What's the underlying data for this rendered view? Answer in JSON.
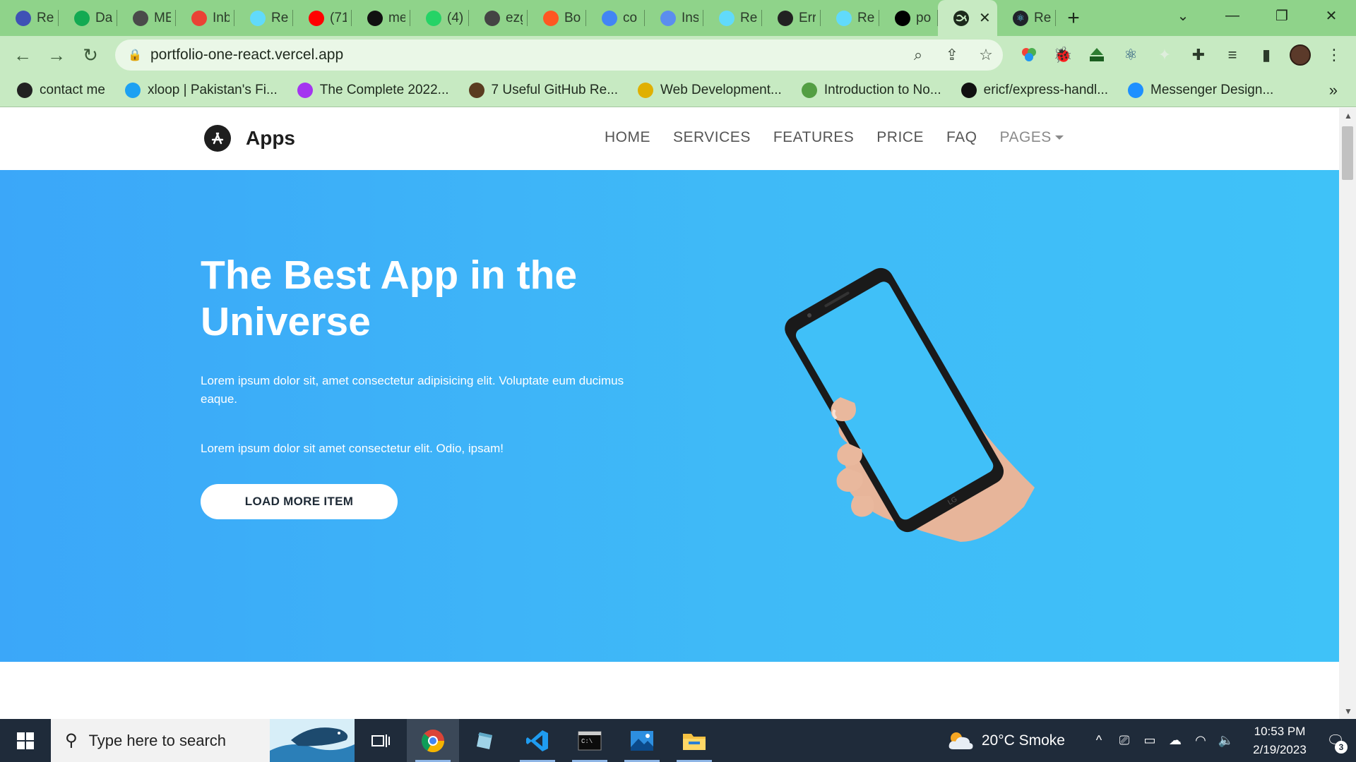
{
  "browser": {
    "tabs": [
      {
        "title": "Re",
        "icon": "m-icon",
        "color": "#3f51b5"
      },
      {
        "title": "Da",
        "icon": "mongodb-leaf-icon",
        "color": "#13aa52"
      },
      {
        "title": "ME",
        "icon": "openai-icon",
        "color": "#4a4a4a"
      },
      {
        "title": "Inb",
        "icon": "gmail-icon",
        "color": "#ea4335"
      },
      {
        "title": "Re",
        "icon": "react-icon",
        "color": "#61dafb"
      },
      {
        "title": "(71",
        "icon": "youtube-icon",
        "color": "#ff0000"
      },
      {
        "title": "me",
        "icon": "github-icon",
        "color": "#111111"
      },
      {
        "title": "(4)",
        "icon": "whatsapp-icon",
        "color": "#25d366"
      },
      {
        "title": "ezg",
        "icon": "ezgif-icon",
        "color": "#444444"
      },
      {
        "title": "Bo",
        "icon": "bolt-icon",
        "color": "#ff5722"
      },
      {
        "title": "co",
        "icon": "google-icon",
        "color": "#4285f4"
      },
      {
        "title": "Ins",
        "icon": "flag-icon",
        "color": "#5b8def"
      },
      {
        "title": "Re",
        "icon": "react-icon",
        "color": "#61dafb"
      },
      {
        "title": "Err",
        "icon": "globe-icon",
        "color": "#222222"
      },
      {
        "title": "Re",
        "icon": "react-icon",
        "color": "#61dafb"
      },
      {
        "title": "po",
        "icon": "vercel-icon",
        "color": "#000000"
      }
    ],
    "active_tab": {
      "title": "",
      "icon": "globe-icon",
      "close": "✕"
    },
    "last_tab": {
      "title": "Re",
      "icon": "react-icon"
    },
    "new_tab_label": "+",
    "url": "portfolio-one-react.vercel.app",
    "bookmarks": [
      {
        "label": "contact me",
        "icon": "globe-icon",
        "color": "#222222"
      },
      {
        "label": "xloop | Pakistan's Fi...",
        "icon": "xloop-icon",
        "color": "#1da1f2"
      },
      {
        "label": "The Complete 2022...",
        "icon": "udemy-icon",
        "color": "#a435f0"
      },
      {
        "label": "7 Useful GitHub Re...",
        "icon": "dev-icon",
        "color": "#5a3c20"
      },
      {
        "label": "Web Development...",
        "icon": "coin-icon",
        "color": "#e0b000"
      },
      {
        "label": "Introduction to No...",
        "icon": "nodejs-icon",
        "color": "#539e43"
      },
      {
        "label": "ericf/express-handl...",
        "icon": "github-icon",
        "color": "#111111"
      },
      {
        "label": "Messenger Design...",
        "icon": "search-app-icon",
        "color": "#1e90ff"
      }
    ]
  },
  "site": {
    "brand": "Apps",
    "brand_logo_letter": "A",
    "nav": [
      "HOME",
      "SERVICES",
      "FEATURES",
      "PRICE",
      "FAQ"
    ],
    "nav_dropdown": "PAGES",
    "hero": {
      "title": "The Best App in the Universe",
      "p1": "Lorem ipsum dolor sit, amet consectetur adipisicing elit. Voluptate eum ducimus eaque.",
      "p2": "Lorem ipsum dolor sit amet consectetur elit. Odio, ipsam!",
      "button": "LOAD MORE ITEM",
      "bg_from": "#3ba7f9",
      "bg_to": "#3fc2f8"
    }
  },
  "taskbar": {
    "search_placeholder": "Type here to search",
    "weather": "20°C  Smoke",
    "time": "10:53 PM",
    "date": "2/19/2023",
    "notification_count": "3"
  }
}
